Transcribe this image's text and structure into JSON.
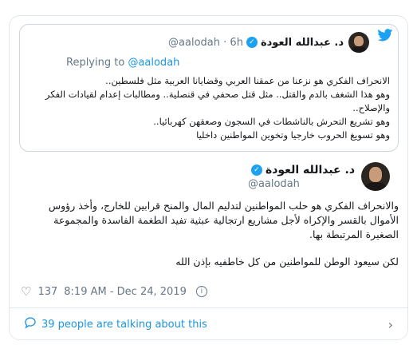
{
  "quoted_tweet": {
    "author_name": "د. عبدالله العودة",
    "author_handle": "@aalodah",
    "time": "6h",
    "replying_prefix": "Replying to",
    "replying_handle": "@aalodah",
    "text_lines": [
      "الانحراف الفكري هو نزعنا من عمقنا العربي وقضايانا العربية مثل فلسطين..",
      "وهو هذا الشغف بالدم والقتل.. مثل قتل صحفي في قنصلية.. ومطالبات إعدام لقيادات الفكر",
      "والإصلاح..",
      "وهو تشريع التحرش بالناشطات في السجون وصعقهن كهربائيا..",
      "وهو تسويغ الحروب خارجيا وتخوين المواطنين داخليا"
    ]
  },
  "main_tweet": {
    "author_name": "د. عبدالله العودة",
    "author_handle": "@aalodah",
    "paragraph1": "والانحراف الفكري هو حلب المواطنين لتدليم المال والمنح قرابين للخارج، وأخذ رؤوس الأموال بالقسر والإكراه لأجل مشاريع ارتجالية عبثية تفيد الطغمة الفاسدة والمجموعة الصغيرة المرتبطة بها.",
    "paragraph2": "لكن سيعود الوطن للمواطنين من كل خاطفيه بإذن الله",
    "likes": "137",
    "timestamp": "8:19 AM - Dec 24, 2019",
    "talking": "39 people are talking about this"
  },
  "icons": {
    "brand": "twitter-bird-icon",
    "like": "heart-icon",
    "info": "info-icon",
    "comment": "comment-bubble-icon",
    "chevron": "chevron-right-icon",
    "verified": "verified-badge-icon"
  },
  "colors": {
    "accent": "#1da1f2",
    "link": "#1b95e0",
    "muted": "#657786",
    "border": "#e1e8ed"
  }
}
